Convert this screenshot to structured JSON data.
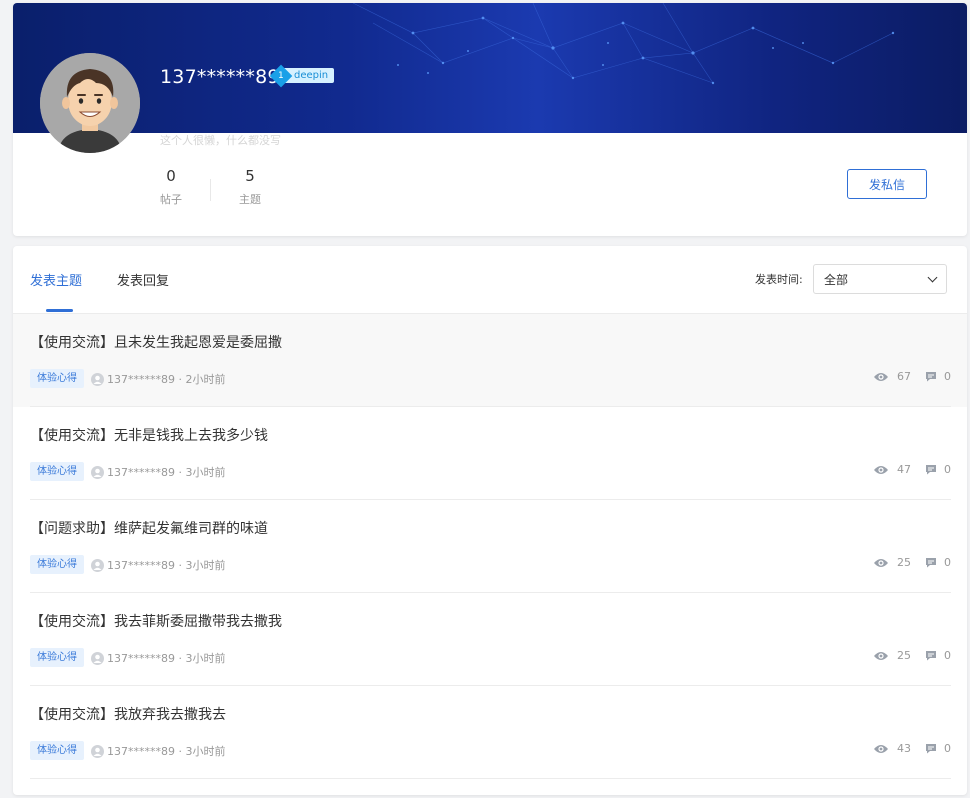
{
  "profile": {
    "username": "137******89",
    "level_number": "1",
    "level_name": "deepin",
    "signature": "这个人很懒，什么都没写",
    "stats": [
      {
        "value": "0",
        "label": "帖子"
      },
      {
        "value": "5",
        "label": "主题"
      }
    ],
    "pm_button_label": "发私信"
  },
  "tabs": [
    {
      "label": "发表主题",
      "active": true
    },
    {
      "label": "发表回复",
      "active": false
    }
  ],
  "filter": {
    "label": "发表时间:",
    "selected": "全部"
  },
  "posts": [
    {
      "title": "【使用交流】且未发生我起恩爱是委屈撒",
      "category": "体验心得",
      "author": "137******89",
      "time": "2小时前",
      "views": "67",
      "replies": "0"
    },
    {
      "title": "【使用交流】无非是钱我上去我多少钱",
      "category": "体验心得",
      "author": "137******89",
      "time": "3小时前",
      "views": "47",
      "replies": "0"
    },
    {
      "title": "【问题求助】维萨起发氟维司群的味道",
      "category": "体验心得",
      "author": "137******89",
      "time": "3小时前",
      "views": "25",
      "replies": "0"
    },
    {
      "title": "【使用交流】我去菲斯委屈撒带我去撒我",
      "category": "体验心得",
      "author": "137******89",
      "time": "3小时前",
      "views": "25",
      "replies": "0"
    },
    {
      "title": "【使用交流】我放弃我去撒我去",
      "category": "体验心得",
      "author": "137******89",
      "time": "3小时前",
      "views": "43",
      "replies": "0"
    }
  ],
  "icons": {
    "view": "eye-icon",
    "reply": "comment-icon",
    "user": "user-icon",
    "dropdown": "chevron-down-icon"
  },
  "colors": {
    "accent": "#2f6fd6",
    "banner": "#112a8f",
    "badge": "#1aa0e8"
  }
}
